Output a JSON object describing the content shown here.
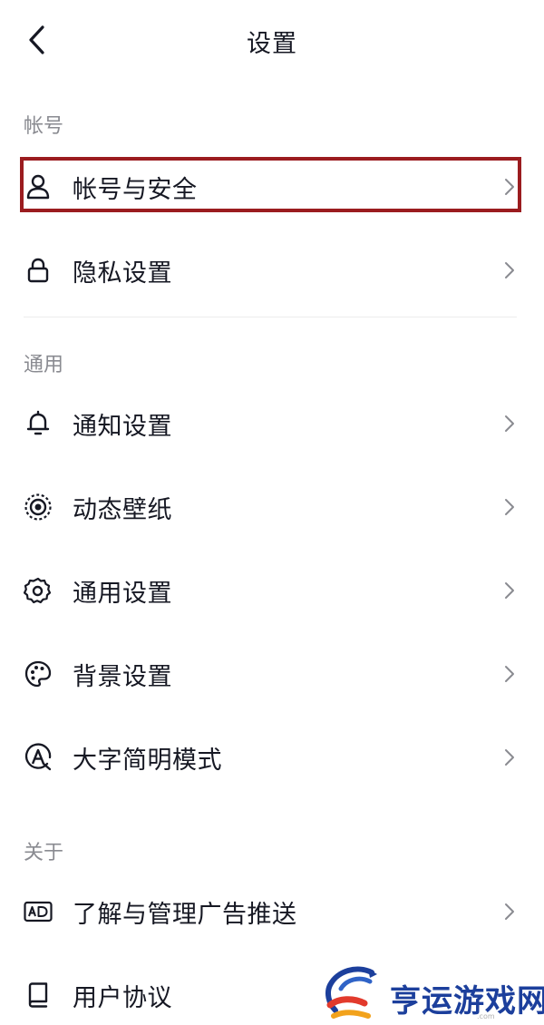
{
  "header": {
    "title": "设置",
    "back_icon": "chevron-left-icon"
  },
  "sections": [
    {
      "label": "帐号",
      "items": [
        {
          "label": "帐号与安全",
          "icon": "user-icon"
        },
        {
          "label": "隐私设置",
          "icon": "lock-icon"
        }
      ]
    },
    {
      "label": "通用",
      "items": [
        {
          "label": "通知设置",
          "icon": "bell-icon"
        },
        {
          "label": "动态壁纸",
          "icon": "live-wallpaper-icon"
        },
        {
          "label": "通用设置",
          "icon": "gear-icon"
        },
        {
          "label": "背景设置",
          "icon": "palette-icon"
        },
        {
          "label": "大字简明模式",
          "icon": "font-size-icon"
        }
      ]
    },
    {
      "label": "关于",
      "items": [
        {
          "label": "了解与管理广告推送",
          "icon": "ad-icon"
        },
        {
          "label": "用户协议",
          "icon": "book-icon"
        }
      ]
    }
  ],
  "highlight": {
    "color": "#9b1c1f"
  },
  "watermark": {
    "text": "亨运游戏网",
    "sub": ".com",
    "color": "#1c3f9c"
  },
  "colors": {
    "text": "#161823",
    "section_label": "#8a8b91",
    "chevron": "#8a8b91",
    "divider": "#ececec"
  }
}
